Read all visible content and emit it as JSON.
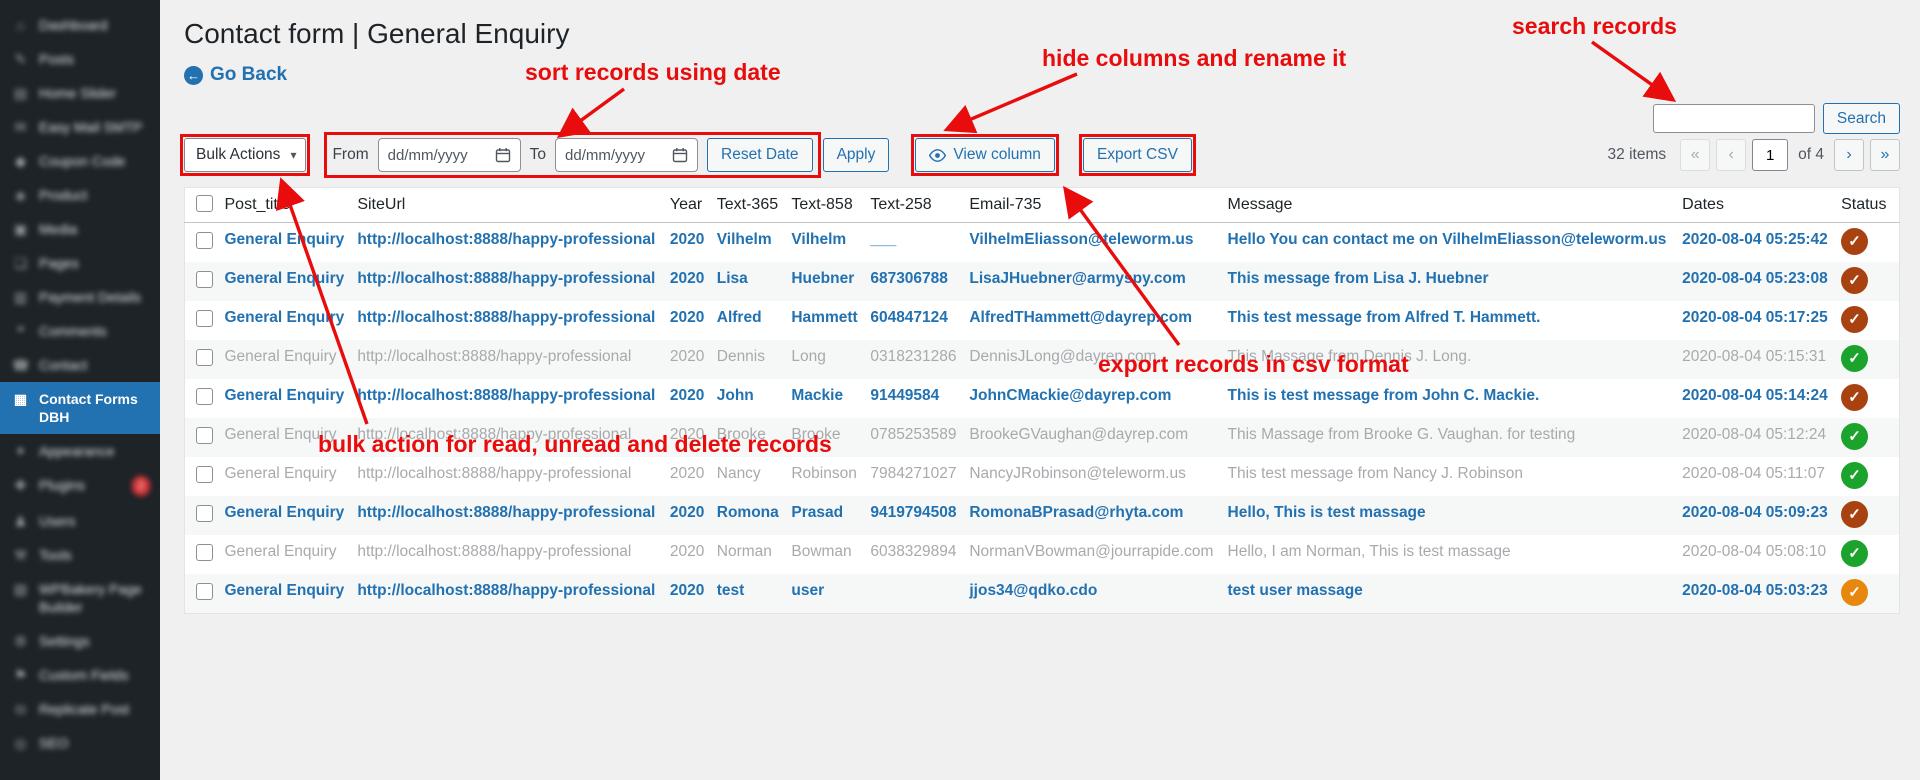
{
  "colors": {
    "accent_blue": "#2271b1",
    "annotation_red": "#e80c0c",
    "status_unread": "#a84311",
    "status_read": "#1ba32c",
    "status_orange": "#e8870e"
  },
  "sidebar": {
    "items": [
      {
        "id": "dashboard",
        "label": "Dashboard",
        "icon": "dashboard-icon",
        "blurred": true
      },
      {
        "id": "posts",
        "label": "Posts",
        "icon": "posts-icon",
        "blurred": true
      },
      {
        "id": "home-slider",
        "label": "Home Slider",
        "icon": "slider-icon",
        "blurred": true
      },
      {
        "id": "easy-mail-smtp",
        "label": "Easy Mail SMTP",
        "icon": "mail-icon",
        "blurred": true
      },
      {
        "id": "coupon-code",
        "label": "Coupon Code",
        "icon": "coupon-icon",
        "blurred": true
      },
      {
        "id": "product",
        "label": "Product",
        "icon": "product-icon",
        "blurred": true
      },
      {
        "id": "media",
        "label": "Media",
        "icon": "media-icon",
        "blurred": true
      },
      {
        "id": "pages",
        "label": "Pages",
        "icon": "pages-icon",
        "blurred": true
      },
      {
        "id": "payment-details",
        "label": "Payment Details",
        "icon": "payment-icon",
        "blurred": true
      },
      {
        "id": "comments",
        "label": "Comments",
        "icon": "comments-icon",
        "blurred": true
      },
      {
        "id": "contact",
        "label": "Contact",
        "icon": "contact-icon",
        "blurred": true
      },
      {
        "id": "contact-forms-dbh",
        "label": "Contact Forms DBH",
        "icon": "grid-icon",
        "blurred": false,
        "active": true
      },
      {
        "id": "appearance",
        "label": "Appearance",
        "icon": "appearance-icon",
        "blurred": true
      },
      {
        "id": "plugins",
        "label": "Plugins",
        "icon": "plugins-icon",
        "blurred": true,
        "badge": "2"
      },
      {
        "id": "users",
        "label": "Users",
        "icon": "users-icon",
        "blurred": true
      },
      {
        "id": "tools",
        "label": "Tools",
        "icon": "tools-icon",
        "blurred": true
      },
      {
        "id": "wpbakery",
        "label": "WPBakery Page Builder",
        "icon": "builder-icon",
        "blurred": true
      },
      {
        "id": "settings",
        "label": "Settings",
        "icon": "settings-icon",
        "blurred": true
      },
      {
        "id": "custom-fields",
        "label": "Custom Fields",
        "icon": "fields-icon",
        "blurred": true
      },
      {
        "id": "replicate-post",
        "label": "Replicate Post",
        "icon": "replicate-icon",
        "blurred": true
      },
      {
        "id": "seo",
        "label": "SEO",
        "icon": "seo-icon",
        "blurred": true
      }
    ]
  },
  "header": {
    "title": "Contact form | General Enquiry",
    "go_back_label": "Go Back"
  },
  "toolbar": {
    "bulk_actions_label": "Bulk Actions",
    "from_label": "From",
    "to_label": "To",
    "date_placeholder": "dd/mm/yyyy",
    "reset_date_label": "Reset Date",
    "apply_label": "Apply",
    "view_column_label": "View column",
    "export_csv_label": "Export CSV"
  },
  "pagination": {
    "items_count": "32 items",
    "first": "«",
    "prev": "‹",
    "current_page": "1",
    "of_label": "of 4",
    "next": "›",
    "last": "»"
  },
  "search": {
    "input_value": "",
    "button_label": "Search"
  },
  "table": {
    "columns": [
      "Post_title",
      "SiteUrl",
      "Year",
      "Text-365",
      "Text-858",
      "Text-258",
      "Email-735",
      "Message",
      "Dates",
      "Status"
    ],
    "rows": [
      {
        "post_title": "General Enquiry",
        "site_url": "http://localhost:8888/happy-professional",
        "year": "2020",
        "text_365": "Vilhelm",
        "text_858": "Vilhelm",
        "text_258": "___",
        "email_735": "VilhelmEliasson@teleworm.us",
        "message": "Hello You can contact me on VilhelmEliasson@teleworm.us",
        "date": "2020-08-04 05:25:42",
        "status": "unread"
      },
      {
        "post_title": "General Enquiry",
        "site_url": "http://localhost:8888/happy-professional",
        "year": "2020",
        "text_365": "Lisa",
        "text_858": "Huebner",
        "text_258": "687306788",
        "email_735": "LisaJHuebner@armyspy.com",
        "message": "This message from Lisa J. Huebner",
        "date": "2020-08-04 05:23:08",
        "status": "unread"
      },
      {
        "post_title": "General Enquiry",
        "site_url": "http://localhost:8888/happy-professional",
        "year": "2020",
        "text_365": "Alfred",
        "text_858": "Hammett",
        "text_258": "604847124",
        "email_735": "AlfredTHammett@dayrep.com",
        "message": "This test message from Alfred T. Hammett.",
        "date": "2020-08-04 05:17:25",
        "status": "unread"
      },
      {
        "post_title": "General Enquiry",
        "site_url": "http://localhost:8888/happy-professional",
        "year": "2020",
        "text_365": "Dennis",
        "text_858": "Long",
        "text_258": "0318231286",
        "email_735": "DennisJLong@dayrep.com",
        "message": "This Massage from Dennis J. Long.",
        "date": "2020-08-04 05:15:31",
        "status": "read"
      },
      {
        "post_title": "General Enquiry",
        "site_url": "http://localhost:8888/happy-professional",
        "year": "2020",
        "text_365": "John",
        "text_858": "Mackie",
        "text_258": "91449584",
        "email_735": "JohnCMackie@dayrep.com",
        "message": "This is test message from John C. Mackie.",
        "date": "2020-08-04 05:14:24",
        "status": "unread"
      },
      {
        "post_title": "General Enquiry",
        "site_url": "http://localhost:8888/happy-professional",
        "year": "2020",
        "text_365": "Brooke",
        "text_858": "Brooke",
        "text_258": "0785253589",
        "email_735": "BrookeGVaughan@dayrep.com",
        "message": "This Massage from Brooke G. Vaughan. for testing",
        "date": "2020-08-04 05:12:24",
        "status": "read"
      },
      {
        "post_title": "General Enquiry",
        "site_url": "http://localhost:8888/happy-professional",
        "year": "2020",
        "text_365": "Nancy",
        "text_858": "Robinson",
        "text_258": "7984271027",
        "email_735": "NancyJRobinson@teleworm.us",
        "message": "This test message from Nancy J. Robinson",
        "date": "2020-08-04 05:11:07",
        "status": "read"
      },
      {
        "post_title": "General Enquiry",
        "site_url": "http://localhost:8888/happy-professional",
        "year": "2020",
        "text_365": "Romona",
        "text_858": "Prasad",
        "text_258": "9419794508",
        "email_735": "RomonaBPrasad@rhyta.com",
        "message": "Hello, This is test massage",
        "date": "2020-08-04 05:09:23",
        "status": "unread"
      },
      {
        "post_title": "General Enquiry",
        "site_url": "http://localhost:8888/happy-professional",
        "year": "2020",
        "text_365": "Norman",
        "text_858": "Bowman",
        "text_258": "6038329894",
        "email_735": "NormanVBowman@jourrapide.com",
        "message": "Hello, I am Norman, This is test massage",
        "date": "2020-08-04 05:08:10",
        "status": "read"
      },
      {
        "post_title": "General Enquiry",
        "site_url": "http://localhost:8888/happy-professional",
        "year": "2020",
        "text_365": "test",
        "text_858": "user",
        "text_258": "",
        "email_735": "jjos34@qdko.cdo",
        "message": "test user massage",
        "date": "2020-08-04 05:03:23",
        "status": "unread_orange"
      }
    ]
  },
  "annotations": {
    "labels": [
      "sort records using date",
      "hide columns and rename it",
      "search records",
      "export records in csv format",
      "bulk action for read, unread and delete records"
    ]
  }
}
